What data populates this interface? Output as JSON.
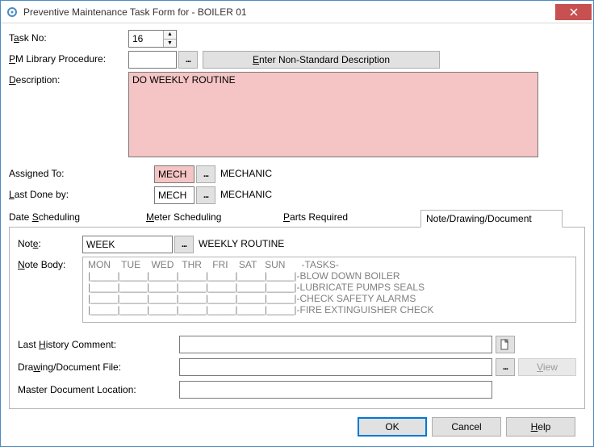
{
  "titlebar": {
    "title": "Preventive Maintenance Task Form for - BOILER 01"
  },
  "form": {
    "task_no_label_pre": "T",
    "task_no_label_u": "a",
    "task_no_label_post": "sk No:",
    "task_no_value": "16",
    "pm_lib_label_u": "P",
    "pm_lib_label_post": "M Library Procedure:",
    "pm_lib_value": "",
    "enter_nonstd_pre": "",
    "enter_nonstd_u": "E",
    "enter_nonstd_post": "nter Non-Standard Description",
    "desc_label_u": "D",
    "desc_label_post": "escription:",
    "desc_value": "DO WEEKLY ROUTINE",
    "assigned_to_label": "Assigned To:",
    "assigned_to_value": "MECH",
    "assigned_to_text": "MECHANIC",
    "last_done_label_pre": "",
    "last_done_label_u": "L",
    "last_done_label_post": "ast Done by:",
    "last_done_value": "MECH",
    "last_done_text": "MECHANIC"
  },
  "tabs": {
    "t1_pre": "Date ",
    "t1_u": "S",
    "t1_post": "cheduling",
    "t2_u": "M",
    "t2_post": "eter Scheduling",
    "t3_u": "P",
    "t3_post": "arts Required",
    "t4": "Note/Drawing/Document"
  },
  "panel": {
    "note_label_pre": "Not",
    "note_label_u": "e",
    "note_label_post": ":",
    "note_value": "WEEK",
    "note_desc": "WEEKLY ROUTINE",
    "notebody_label_u": "N",
    "notebody_label_post": "ote Body:",
    "notebody_text": "MON    TUE    WED   THR    FRI    SAT   SUN      -TASKS-\n|_____|_____|_____|_____|_____|_____|_____|-BLOW DOWN BOILER\n|_____|_____|_____|_____|_____|_____|_____|-LUBRICATE PUMPS SEALS\n|_____|_____|_____|_____|_____|_____|_____|-CHECK SAFETY ALARMS\n|_____|_____|_____|_____|_____|_____|_____|-FIRE EXTINGUISHER CHECK",
    "last_hist_pre": "Last ",
    "last_hist_u": "H",
    "last_hist_post": "istory Comment:",
    "last_hist_value": "",
    "drawdoc_pre": "Dra",
    "drawdoc_u": "w",
    "drawdoc_post": "ing/Document File:",
    "drawdoc_value": "",
    "view_u": "V",
    "view_post": "iew",
    "master_loc_label": "Master Document Location:",
    "master_loc_value": ""
  },
  "footer": {
    "ok": "OK",
    "cancel": "Cancel",
    "help_u": "H",
    "help_post": "elp"
  }
}
